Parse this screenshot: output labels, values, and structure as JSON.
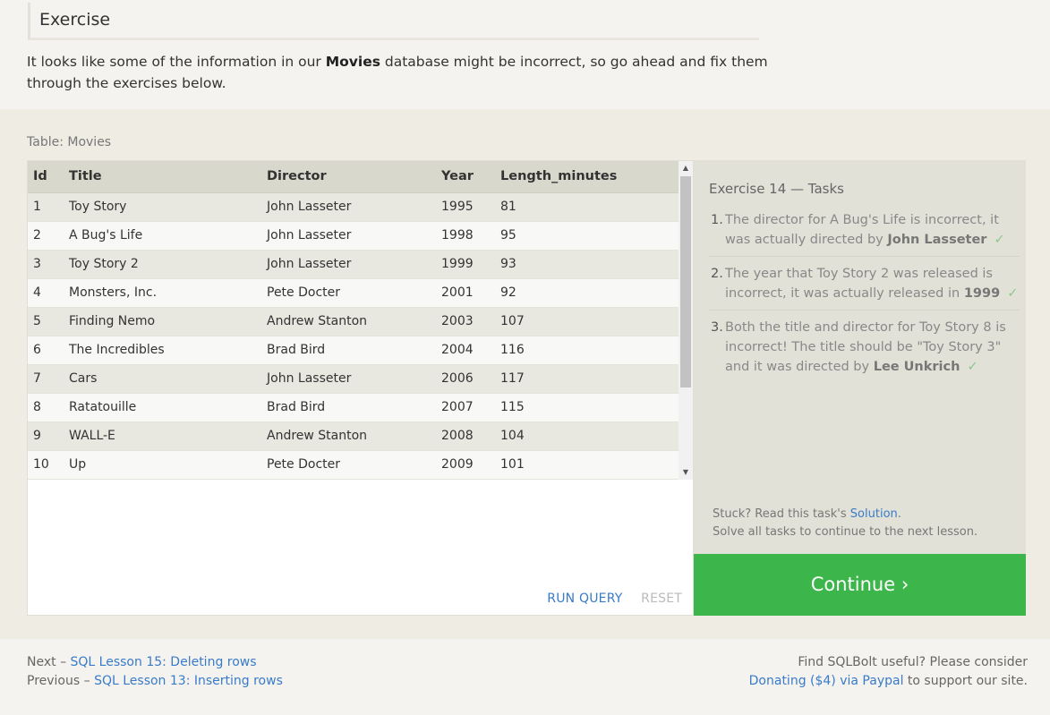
{
  "exercise": {
    "heading": "Exercise",
    "intro_before": "It looks like some of the information in our ",
    "intro_bold": "Movies",
    "intro_after": " database might be incorrect, so go ahead and fix them through the exercises below."
  },
  "table": {
    "caption": "Table: Movies",
    "columns": [
      "Id",
      "Title",
      "Director",
      "Year",
      "Length_minutes"
    ],
    "rows": [
      [
        "1",
        "Toy Story",
        "John Lasseter",
        "1995",
        "81"
      ],
      [
        "2",
        "A Bug's Life",
        "John Lasseter",
        "1998",
        "95"
      ],
      [
        "3",
        "Toy Story 2",
        "John Lasseter",
        "1999",
        "93"
      ],
      [
        "4",
        "Monsters, Inc.",
        "Pete Docter",
        "2001",
        "92"
      ],
      [
        "5",
        "Finding Nemo",
        "Andrew Stanton",
        "2003",
        "107"
      ],
      [
        "6",
        "The Incredibles",
        "Brad Bird",
        "2004",
        "116"
      ],
      [
        "7",
        "Cars",
        "John Lasseter",
        "2006",
        "117"
      ],
      [
        "8",
        "Ratatouille",
        "Brad Bird",
        "2007",
        "115"
      ],
      [
        "9",
        "WALL-E",
        "Andrew Stanton",
        "2008",
        "104"
      ],
      [
        "10",
        "Up",
        "Pete Docter",
        "2009",
        "101"
      ]
    ],
    "run_label": "RUN QUERY",
    "reset_label": "RESET"
  },
  "tasks": {
    "title": "Exercise 14 — Tasks",
    "items": [
      {
        "num": "1.",
        "text": "The director for A Bug's Life is incorrect, it was actually directed by ",
        "bold": "John Lasseter",
        "check": "✓"
      },
      {
        "num": "2.",
        "text": "The year that Toy Story 2 was released is incorrect, it was actually released in ",
        "bold": "1999",
        "check": "✓"
      },
      {
        "num": "3.",
        "text": "Both the title and director for Toy Story 8 is incorrect! The title should be \"Toy Story 3\" and it was directed by ",
        "bold": "Lee Unkrich",
        "check": "✓"
      }
    ],
    "stuck_prefix": "Stuck? Read this task's ",
    "solution_link": "Solution",
    "stuck_suffix": ".",
    "solve_note": "Solve all tasks to continue to the next lesson.",
    "continue_label": "Continue ›"
  },
  "footer": {
    "next_prefix": "Next – ",
    "next_link": "SQL Lesson 15: Deleting rows",
    "prev_prefix": "Previous – ",
    "prev_link": "SQL Lesson 13: Inserting rows",
    "support_line1": "Find SQLBolt useful? Please consider",
    "donate_link": "Donating ($4) via Paypal",
    "support_suffix": " to support our site."
  },
  "icons": {
    "scroll_up": "scroll-up-arrow-icon",
    "scroll_down": "scroll-down-arrow-icon",
    "check": "checkmark-icon"
  },
  "colors": {
    "continue_bg": "#3cb54a",
    "link": "#3a7bc8",
    "header_row": "#d8d8cc"
  }
}
